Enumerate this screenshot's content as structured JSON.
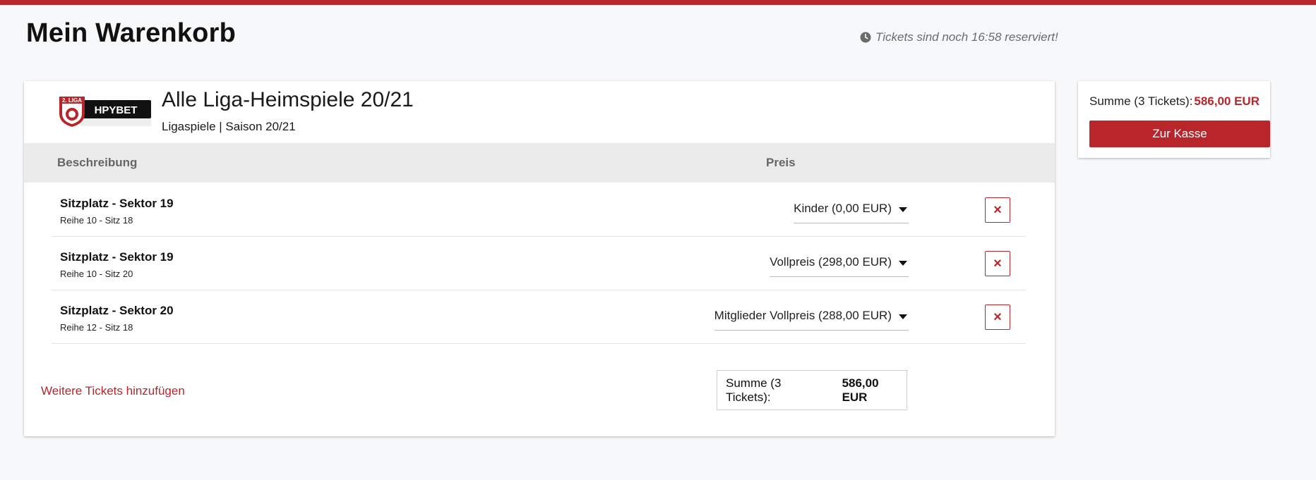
{
  "header": {
    "title": "Mein Warenkorb",
    "timer_text": "Tickets sind noch 16:58 reserviert!"
  },
  "event": {
    "logo_alt": "2. LIGA HPYBET",
    "logo_text_top": "2. LIGA",
    "logo_text_brand": "HPYBET",
    "title": "Alle Liga-Heimspiele 20/21",
    "subtitle": "Ligaspiele | Saison 20/21"
  },
  "table": {
    "col_description": "Beschreibung",
    "col_price": "Preis",
    "rows": [
      {
        "seat": "Sitzplatz - Sektor 19",
        "location": "Reihe 10 - Sitz 18",
        "price_option": "Kinder (0,00 EUR)"
      },
      {
        "seat": "Sitzplatz - Sektor 19",
        "location": "Reihe 10 - Sitz 20",
        "price_option": "Vollpreis (298,00 EUR)"
      },
      {
        "seat": "Sitzplatz - Sektor 20",
        "location": "Reihe 12 - Sitz 18",
        "price_option": "Mitglieder Vollpreis (288,00 EUR)"
      }
    ],
    "delete_icon": "×"
  },
  "footer": {
    "add_more_link": "Weitere Tickets hinzufügen",
    "sum_label": "Summe (3 Tickets):",
    "sum_amount": "586,00 EUR"
  },
  "sidebar": {
    "sum_label": "Summe (3 Tickets):",
    "sum_amount": "586,00 EUR",
    "checkout_label": "Zur Kasse"
  },
  "colors": {
    "accent": "#b8262c",
    "background": "#f7f8fa",
    "table_header": "#ebebeb"
  }
}
